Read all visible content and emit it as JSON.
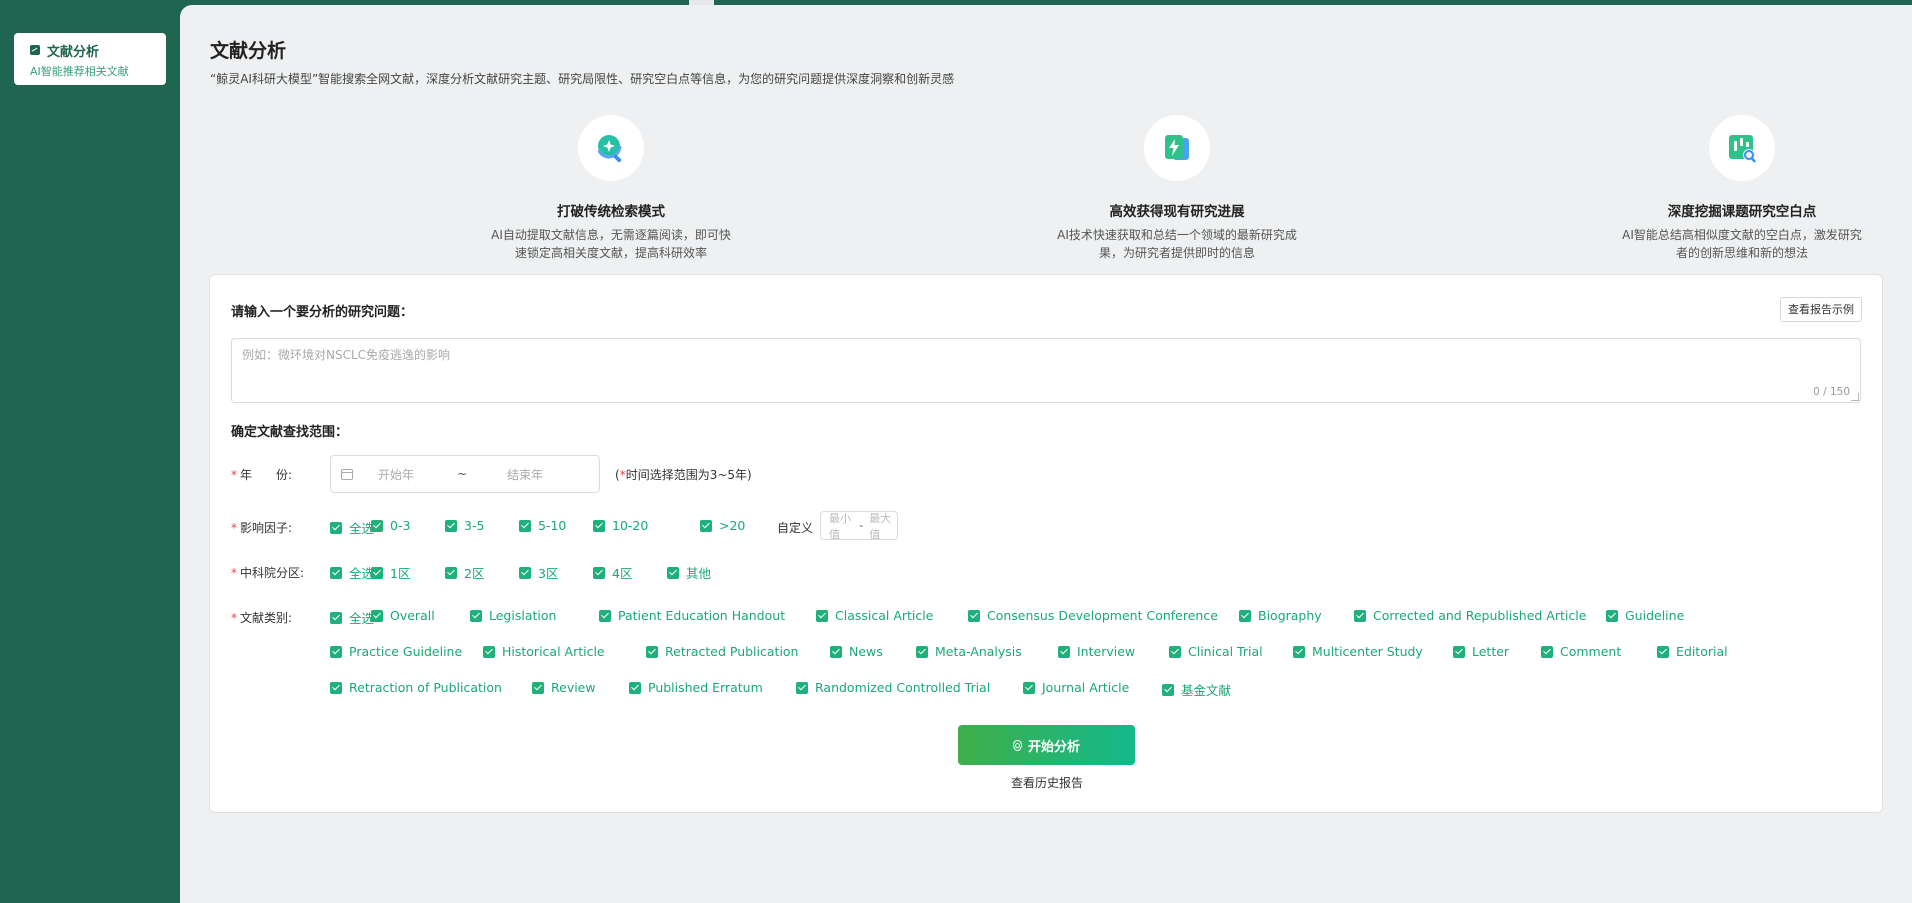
{
  "sidebar": {
    "item_title": "文献分析",
    "item_sub": "AI智能推荐相关文献",
    "item_icon": "chart-icon"
  },
  "page": {
    "title": "文献分析",
    "description": "“鲸灵AI科研大模型”智能搜索全网文献，深度分析文献研究主题、研究局限性、研究空白点等信息，为您的研究问题提供深度洞察和创新灵感"
  },
  "features": [
    {
      "icon": "magnify-plus-icon",
      "title": "打破传统检索模式",
      "desc": "AI自动提取文献信息，无需逐篇阅读，即可快速锁定高相关度文献，提高科研效率"
    },
    {
      "icon": "lightning-doc-icon",
      "title": "高效获得现有研究进展",
      "desc": "AI技术快速获取和总结一个领域的最新研究成果，为研究者提供即时的信息"
    },
    {
      "icon": "chart-search-icon",
      "title": "深度挖掘课题研究空白点",
      "desc": "AI智能总结高相似度文献的空白点，激发研究者的创新思维和新的想法"
    }
  ],
  "question": {
    "label": "请输入一个要分析的研究问题：",
    "example_button": "查看报告示例",
    "placeholder": "例如：微环境对NSCLC免疫逃逸的影响",
    "value": "",
    "counter": "0 / 150"
  },
  "range": {
    "label": "确定文献查找范围：",
    "required_mark": "*",
    "year": {
      "label": "年　　份:",
      "start_placeholder": "开始年",
      "separator": "~",
      "end_placeholder": "结束年",
      "hint_open": "(",
      "hint_mark": "*",
      "hint_text": "时间选择范围为3~5年)"
    },
    "impact": {
      "label": "影响因子:",
      "options": [
        "全选",
        "0-3",
        "3-5",
        "5-10",
        "10-20",
        ">20"
      ],
      "custom_label": "自定义",
      "min_placeholder": "最小值",
      "dash": "-",
      "max_placeholder": "最大值"
    },
    "cas": {
      "label": "中科院分区:",
      "options": [
        "全选",
        "1区",
        "2区",
        "3区",
        "4区",
        "其他"
      ]
    },
    "doc_type": {
      "label": "文献类别:",
      "options": [
        "全选",
        "Overall",
        "Legislation",
        "Patient Education Handout",
        "Classical Article",
        "Consensus Development Conference",
        "Biography",
        "Corrected and Republished Article",
        "Guideline",
        "Practice Guideline",
        "Historical Article",
        "Retracted Publication",
        "News",
        "Meta-Analysis",
        "Interview",
        "Clinical Trial",
        "Multicenter Study",
        "Letter",
        "Comment",
        "Editorial",
        "Retraction of Publication",
        "Review",
        "Published Erratum",
        "Randomized Controlled Trial",
        "Journal Article",
        "基金文献"
      ]
    }
  },
  "actions": {
    "start_button": "开始分析",
    "history_link": "查看历史报告"
  },
  "colors": {
    "sidebar": "#1f6650",
    "accent": "#20b07c",
    "required": "#e54545"
  }
}
